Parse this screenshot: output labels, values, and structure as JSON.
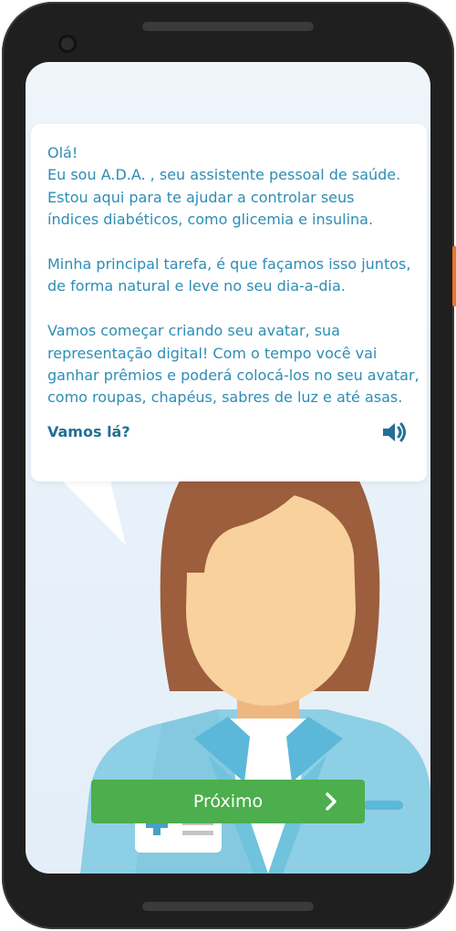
{
  "bubble": {
    "message": "Olá!\nEu sou A.D.A. , seu assistente pessoal de saúde.\nEstou aqui para te ajudar a controlar seus\níndices diabéticos, como glicemia e insulina.\n\nMinha principal tarefa, é que façamos isso juntos,\nde forma natural e leve no seu dia-a-dia.\n\nVamos começar criando seu avatar, sua\nrepresentação digital! Com o tempo você vai\nganhar prêmios e poderá colocá-los no seu avatar,\ncomo roupas, chapéus, sabres de luz e até asas.",
    "cta": "Vamos lá?",
    "sound_icon": "speaker-icon"
  },
  "next_button": {
    "label": "Próximo",
    "icon": "chevron-right-icon"
  },
  "colors": {
    "text": "#2d8db5",
    "cta": "#236f95",
    "button": "#4cae4c",
    "hair": "#9c5e3d",
    "skin": "#f8d19d",
    "shirt": "#8dcfe4"
  }
}
